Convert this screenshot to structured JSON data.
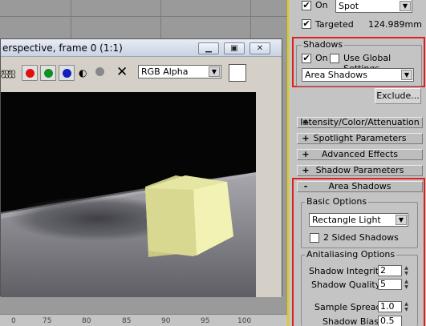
{
  "light_params": {
    "on_label": "On",
    "on_checked": true,
    "light_type": "Spot",
    "targeted_label": "Targeted",
    "targeted_checked": true,
    "target_distance": "124.989mm"
  },
  "shadows_group": {
    "title": "Shadows",
    "on_label": "On",
    "on_checked": true,
    "use_global_label": "Use Global Settings",
    "use_global_checked": false,
    "shadow_type": "Area Shadows",
    "exclude_label": "Exclude..."
  },
  "rollouts": [
    {
      "sign": "+",
      "label": "Intensity/Color/Attenuation"
    },
    {
      "sign": "+",
      "label": "Spotlight Parameters"
    },
    {
      "sign": "+",
      "label": "Advanced Effects"
    },
    {
      "sign": "+",
      "label": "Shadow Parameters"
    },
    {
      "sign": "-",
      "label": "Area Shadows"
    }
  ],
  "area_shadows": {
    "basic_title": "Basic Options",
    "light_shape": "Rectangle Light",
    "two_sided_label": "2 Sided Shadows",
    "two_sided_checked": false,
    "aa_title": "Anitaliasing Options",
    "shadow_integrity_label": "Shadow Integrity:",
    "shadow_integrity": "2",
    "shadow_quality_label": "Shadow Quality:",
    "shadow_quality": "5",
    "sample_spread_label": "Sample Spread:",
    "sample_spread": "1.0",
    "shadow_bias_label": "Shadow Bias:",
    "shadow_bias": "0.5"
  },
  "render_window": {
    "title": "erspective, frame 0 (1:1)",
    "channel": "RGB Alpha",
    "minimize_icon": "minimize-icon",
    "restore_icon": "restore-icon",
    "close_icon": "close-icon"
  },
  "ruler": {
    "ticks": [
      "0",
      "75",
      "80",
      "85",
      "90",
      "95",
      "100"
    ]
  },
  "colors": {
    "highlight_red": "#e02020",
    "cube_face": "#e2e29a",
    "panel_bg": "#c4c4c4"
  }
}
